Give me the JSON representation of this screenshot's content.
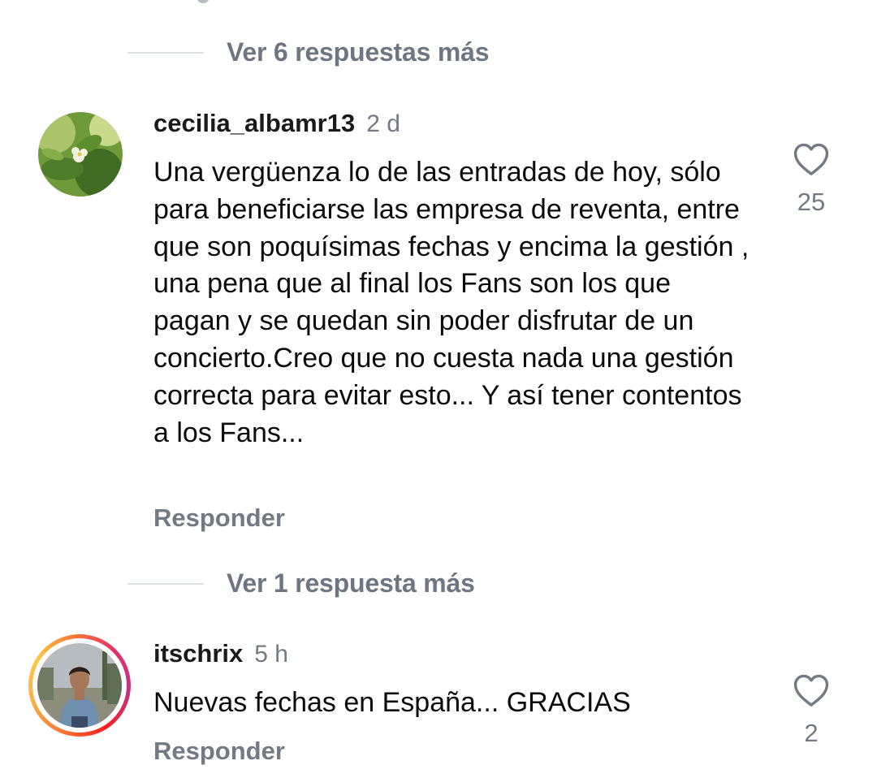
{
  "thread": {
    "view_more_1": "Ver 6 respuestas más",
    "view_more_2": "Ver 1 respuesta más"
  },
  "comments": [
    {
      "username": "cecilia_albamr13",
      "time": "2 d",
      "text": "Una vergüenza lo de las entradas de hoy, sólo para beneficiarse las empresa de reventa, entre que son poquísimas fechas y encima la gestión , una pena que al final los Fans son los que pagan y se quedan sin poder disfrutar de un concierto.Creo que no cuesta nada una gestión correcta para evitar esto... Y así tener contentos a los Fans...",
      "reply_label": "Responder",
      "likes": "25",
      "like_icon": "heart-outline-icon"
    },
    {
      "username": "itschrix",
      "time": "5 h",
      "text": "Nuevas fechas en España... GRACIAS",
      "reply_label": "Responder",
      "likes": "2",
      "like_icon": "heart-outline-icon",
      "has_story": true
    }
  ],
  "colors": {
    "muted_text": "#737a83",
    "replies_text": "#6e7681",
    "divider": "#dde0e4"
  }
}
